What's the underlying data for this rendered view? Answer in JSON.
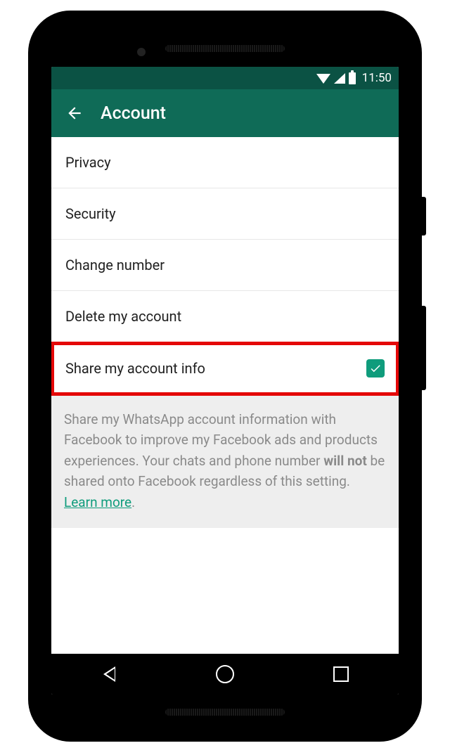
{
  "status_bar": {
    "time": "11:50"
  },
  "app_bar": {
    "title": "Account"
  },
  "menu": {
    "privacy": "Privacy",
    "security": "Security",
    "change_number": "Change number",
    "delete_account": "Delete my account",
    "share_info": "Share my account info",
    "share_info_checked": true
  },
  "info": {
    "text_before": "Share my WhatsApp account information with Facebook to improve my Facebook ads and products experiences. Your chats and phone number ",
    "bold_text": "will not",
    "text_after": " be shared onto Facebook regardless of this setting. ",
    "link_text": "Learn more",
    "period": "."
  }
}
